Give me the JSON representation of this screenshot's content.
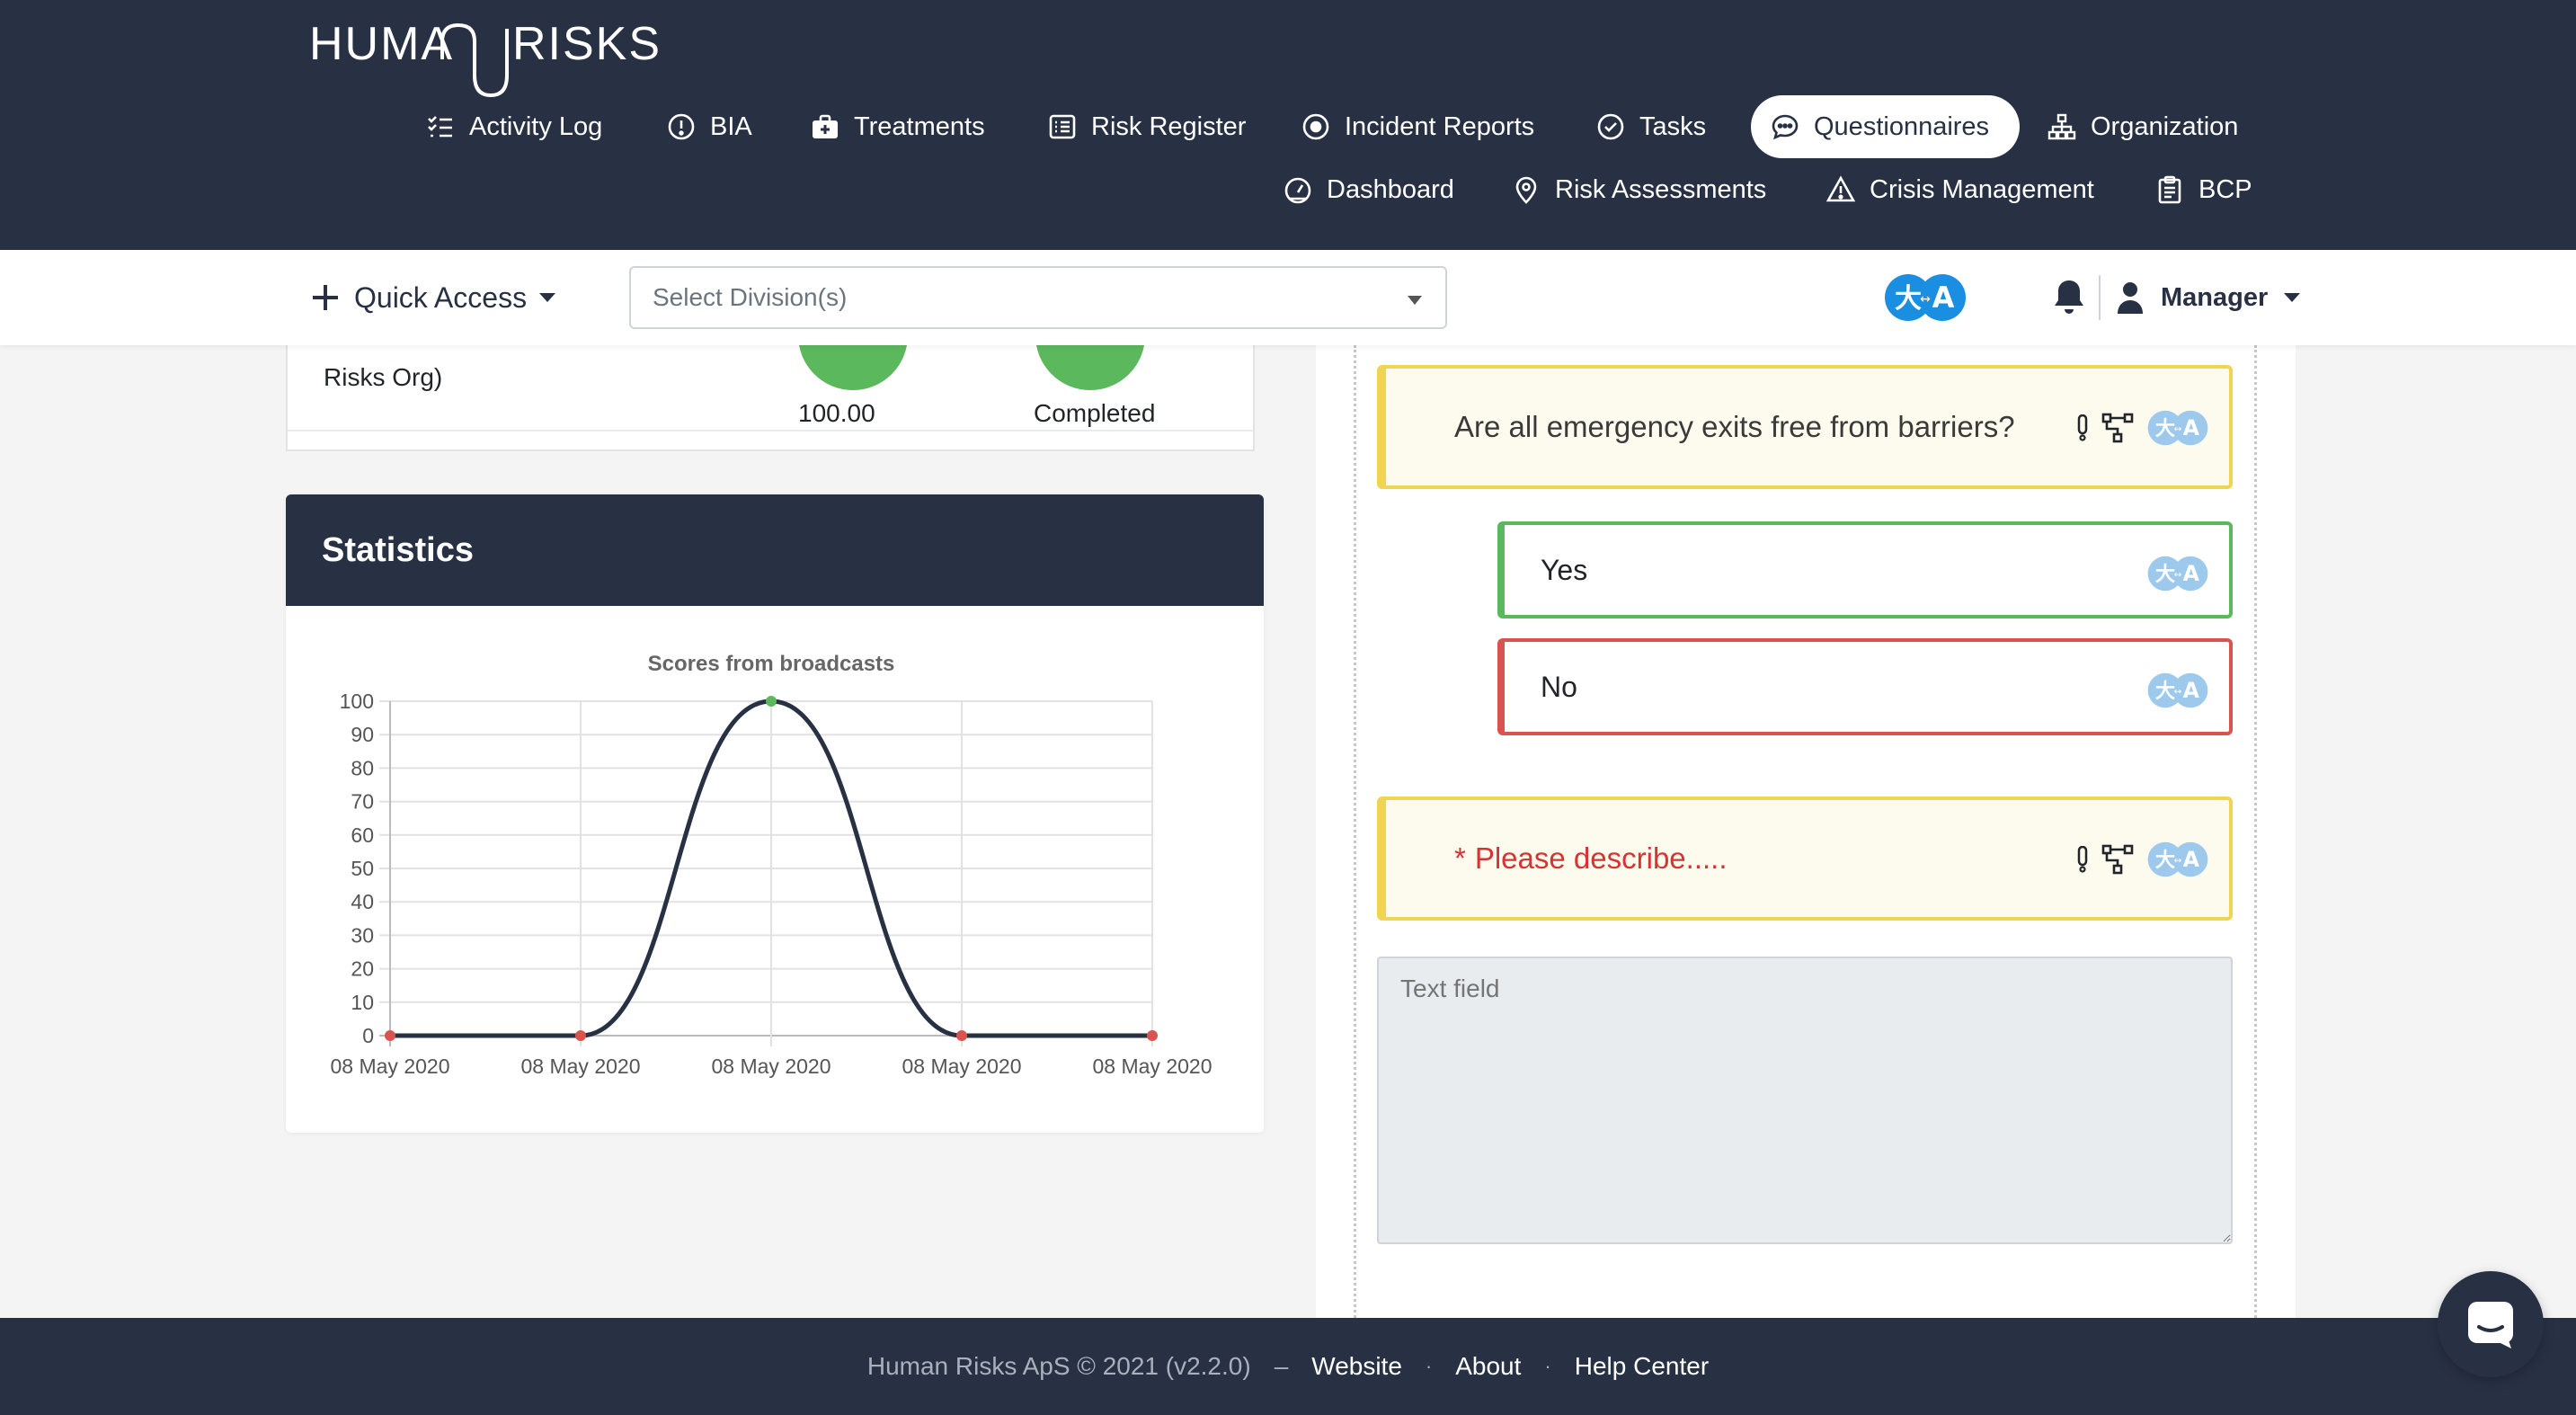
{
  "brand": {
    "logo_text": "HUMAN RISKS"
  },
  "nav": {
    "row1": [
      {
        "label": "Activity Log",
        "icon": "list-check-icon"
      },
      {
        "label": "BIA",
        "icon": "exclamation-circle-icon"
      },
      {
        "label": "Treatments",
        "icon": "briefcase-medical-icon"
      },
      {
        "label": "Risk Register",
        "icon": "list-alt-icon"
      },
      {
        "label": "Incident Reports",
        "icon": "dot-circle-icon"
      },
      {
        "label": "Tasks",
        "icon": "check-circle-icon"
      },
      {
        "label": "Questionnaires",
        "icon": "comment-dots-icon",
        "active": true
      },
      {
        "label": "Organization",
        "icon": "sitemap-icon"
      }
    ],
    "row2": [
      {
        "label": "Dashboard",
        "icon": "gauge-icon"
      },
      {
        "label": "Risk Assessments",
        "icon": "map-marker-icon"
      },
      {
        "label": "Crisis Management",
        "icon": "warning-triangle-icon"
      },
      {
        "label": "BCP",
        "icon": "clipboard-icon"
      }
    ]
  },
  "subbar": {
    "quick_access": "Quick Access",
    "division_placeholder": "Select Division(s)",
    "user": "Manager"
  },
  "left_table_row": {
    "label": "Risks Org)",
    "score": "100.00",
    "status": "Completed"
  },
  "statistics": {
    "title": "Statistics"
  },
  "chart_data": {
    "type": "line",
    "title": "Scores from broadcasts",
    "categories": [
      "08 May 2020",
      "08 May 2020",
      "08 May 2020",
      "08 May 2020",
      "08 May 2020"
    ],
    "values": [
      0,
      0,
      100,
      0,
      0
    ],
    "point_colors": [
      "#d9534f",
      "#d9534f",
      "#5cb85c",
      "#d9534f",
      "#d9534f"
    ],
    "line_color": "#283144",
    "ylim": [
      0,
      100
    ],
    "yticks": [
      0,
      10,
      20,
      30,
      40,
      50,
      60,
      70,
      80,
      90,
      100
    ],
    "grid": true,
    "xlabel": "",
    "ylabel": ""
  },
  "questionnaire": {
    "question1": "Are all emergency exits free from barriers?",
    "answer_yes": "Yes",
    "answer_no": "No",
    "question2_marker": "*",
    "question2": "Please describe.....",
    "text_placeholder": "Text field"
  },
  "footer": {
    "copyright": "Human Risks ApS © 2021 (v2.2.0)",
    "dash": "–",
    "links": [
      "Website",
      "About",
      "Help Center"
    ]
  },
  "colors": {
    "navy": "#283144",
    "accent_blue": "#1a8ee0",
    "green": "#5cb85c",
    "red": "#d9534f",
    "yellow": "#f0d552"
  }
}
